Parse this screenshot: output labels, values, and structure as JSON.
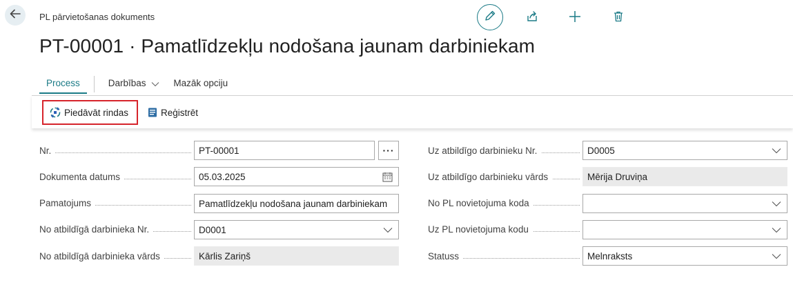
{
  "header": {
    "breadcrumb": "PL pārvietošanas dokuments",
    "title": "PT-00001 · Pamatlīdzekļu nodošana jaunam darbiniekam"
  },
  "tabs": {
    "process": "Process",
    "actions": "Darbības",
    "fewer": "Mazāk opciju"
  },
  "actions": {
    "suggest": "Piedāvāt rindas",
    "register": "Reģistrēt"
  },
  "form": {
    "left": [
      {
        "label": "Nr.",
        "value": "PT-00001"
      },
      {
        "label": "Dokumenta datums",
        "value": "05.03.2025"
      },
      {
        "label": "Pamatojums",
        "value": "Pamatlīdzekļu nodošana jaunam darbiniekam"
      },
      {
        "label": "No atbildīgā darbinieka Nr.",
        "value": "D0001"
      },
      {
        "label": "No atbildīgā darbinieka vārds",
        "value": "Kārlis Zariņš"
      }
    ],
    "right": [
      {
        "label": "Uz atbildīgo darbinieku Nr.",
        "value": "D0005"
      },
      {
        "label": "Uz atbildīgo darbinieku vārds",
        "value": "Mērija Druviņa"
      },
      {
        "label": "No PL novietojuma koda",
        "value": ""
      },
      {
        "label": "Uz PL novietojuma kodu",
        "value": ""
      },
      {
        "label": "Statuss",
        "value": "Melnraksts"
      }
    ],
    "ellipsis": "···"
  },
  "colors": {
    "accent": "#1a7a86",
    "highlight": "#d6232a",
    "readonly_bg": "#eaeaea"
  },
  "icons": {
    "back": "arrow-left-icon",
    "edit": "pencil-icon",
    "share": "share-icon",
    "add": "plus-icon",
    "delete": "trash-icon",
    "suggest": "suggest-lines-icon",
    "register": "post-icon",
    "calendar": "calendar-icon",
    "dropdown": "chevron-down-icon"
  }
}
